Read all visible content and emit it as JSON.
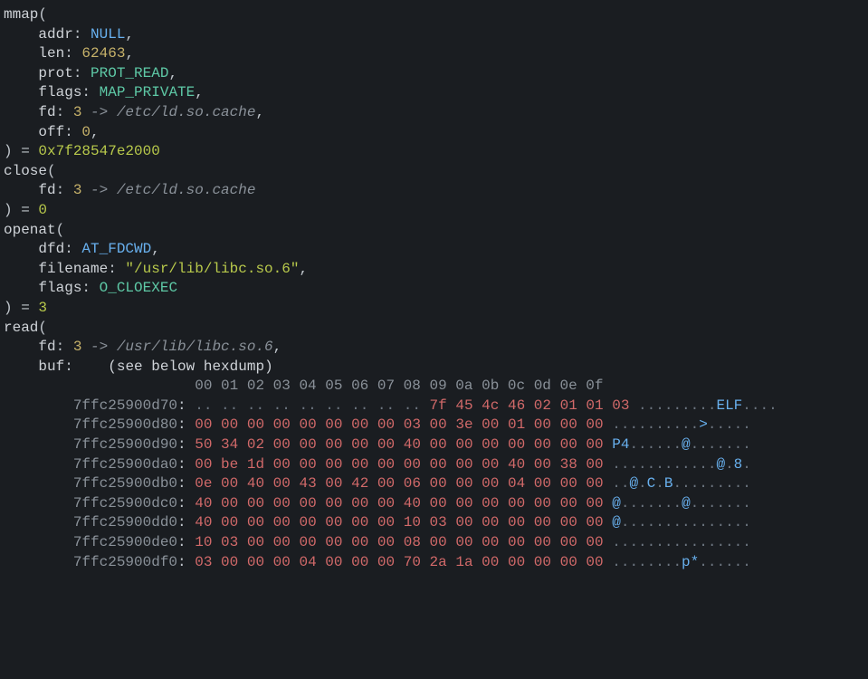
{
  "syscalls": [
    {
      "name": "mmap",
      "params": [
        {
          "key": "addr",
          "value": "NULL",
          "cls": "null"
        },
        {
          "key": "len",
          "value": "62463",
          "cls": "num"
        },
        {
          "key": "prot",
          "value": "PROT_READ",
          "cls": "flag"
        },
        {
          "key": "flags",
          "value": "MAP_PRIVATE",
          "cls": "flag"
        },
        {
          "key": "fd",
          "value": "3",
          "cls": "fd",
          "follow": " -> /etc/ld.so.cache",
          "followcls": "path"
        },
        {
          "key": "off",
          "value": "0",
          "cls": "num"
        }
      ],
      "ret": "0x7f28547e2000"
    },
    {
      "name": "close",
      "params": [
        {
          "key": "fd",
          "value": "3",
          "cls": "fd",
          "follow": " -> /etc/ld.so.cache",
          "followcls": "path",
          "nocomma": true
        }
      ],
      "ret": "0"
    },
    {
      "name": "openat",
      "params": [
        {
          "key": "dfd",
          "value": "AT_FDCWD",
          "cls": "null"
        },
        {
          "key": "filename",
          "value": "\"/usr/lib/libc.so.6\"",
          "cls": "str"
        },
        {
          "key": "flags",
          "value": "O_CLOEXEC",
          "cls": "flag",
          "nocomma": true
        }
      ],
      "ret": "3"
    }
  ],
  "read": {
    "name": "read",
    "fd_label": "fd",
    "fd_value": "3",
    "fd_follow": " -> /usr/lib/libc.so.6",
    "buf_label": "buf",
    "buf_note": "(see below hexdump)"
  },
  "hexdump": {
    "header": "00 01 02 03 04 05 06 07 08 09 0a 0b 0c 0d 0e 0f",
    "rows": [
      {
        "addr": "7ffc25900d70",
        "lead_dots": 9,
        "bytes": [
          "7f",
          "45",
          "4c",
          "46",
          "02",
          "01",
          "01",
          "03"
        ],
        "ascii": [
          {
            "t": ".........",
            "c": "ascii"
          },
          {
            "t": "ELF",
            "c": "asciih"
          },
          {
            "t": "....",
            "c": "ascii"
          }
        ]
      },
      {
        "addr": "7ffc25900d80",
        "lead_dots": 0,
        "bytes": [
          "00",
          "00",
          "00",
          "00",
          "00",
          "00",
          "00",
          "00",
          "03",
          "00",
          "3e",
          "00",
          "01",
          "00",
          "00",
          "00"
        ],
        "ascii": [
          {
            "t": "..........",
            "c": "ascii"
          },
          {
            "t": ">",
            "c": "asciih"
          },
          {
            "t": ".....",
            "c": "ascii"
          }
        ]
      },
      {
        "addr": "7ffc25900d90",
        "lead_dots": 0,
        "bytes": [
          "50",
          "34",
          "02",
          "00",
          "00",
          "00",
          "00",
          "00",
          "40",
          "00",
          "00",
          "00",
          "00",
          "00",
          "00",
          "00"
        ],
        "ascii": [
          {
            "t": "P4",
            "c": "asciih"
          },
          {
            "t": "......",
            "c": "ascii"
          },
          {
            "t": "@",
            "c": "asciih"
          },
          {
            "t": ".......",
            "c": "ascii"
          }
        ]
      },
      {
        "addr": "7ffc25900da0",
        "lead_dots": 0,
        "bytes": [
          "00",
          "be",
          "1d",
          "00",
          "00",
          "00",
          "00",
          "00",
          "00",
          "00",
          "00",
          "00",
          "40",
          "00",
          "38",
          "00"
        ],
        "ascii": [
          {
            "t": "............",
            "c": "ascii"
          },
          {
            "t": "@",
            "c": "asciih"
          },
          {
            "t": ".",
            "c": "ascii"
          },
          {
            "t": "8",
            "c": "asciih"
          },
          {
            "t": ".",
            "c": "ascii"
          }
        ]
      },
      {
        "addr": "7ffc25900db0",
        "lead_dots": 0,
        "bytes": [
          "0e",
          "00",
          "40",
          "00",
          "43",
          "00",
          "42",
          "00",
          "06",
          "00",
          "00",
          "00",
          "04",
          "00",
          "00",
          "00"
        ],
        "ascii": [
          {
            "t": "..",
            "c": "ascii"
          },
          {
            "t": "@",
            "c": "asciih"
          },
          {
            "t": ".",
            "c": "ascii"
          },
          {
            "t": "C",
            "c": "asciih"
          },
          {
            "t": ".",
            "c": "ascii"
          },
          {
            "t": "B",
            "c": "asciih"
          },
          {
            "t": ".........",
            "c": "ascii"
          }
        ]
      },
      {
        "addr": "7ffc25900dc0",
        "lead_dots": 0,
        "bytes": [
          "40",
          "00",
          "00",
          "00",
          "00",
          "00",
          "00",
          "00",
          "40",
          "00",
          "00",
          "00",
          "00",
          "00",
          "00",
          "00"
        ],
        "ascii": [
          {
            "t": "@",
            "c": "asciih"
          },
          {
            "t": ".......",
            "c": "ascii"
          },
          {
            "t": "@",
            "c": "asciih"
          },
          {
            "t": ".......",
            "c": "ascii"
          }
        ]
      },
      {
        "addr": "7ffc25900dd0",
        "lead_dots": 0,
        "bytes": [
          "40",
          "00",
          "00",
          "00",
          "00",
          "00",
          "00",
          "00",
          "10",
          "03",
          "00",
          "00",
          "00",
          "00",
          "00",
          "00"
        ],
        "ascii": [
          {
            "t": "@",
            "c": "asciih"
          },
          {
            "t": "...............",
            "c": "ascii"
          }
        ]
      },
      {
        "addr": "7ffc25900de0",
        "lead_dots": 0,
        "bytes": [
          "10",
          "03",
          "00",
          "00",
          "00",
          "00",
          "00",
          "00",
          "08",
          "00",
          "00",
          "00",
          "00",
          "00",
          "00",
          "00"
        ],
        "ascii": [
          {
            "t": "................",
            "c": "ascii"
          }
        ]
      },
      {
        "addr": "7ffc25900df0",
        "lead_dots": 0,
        "bytes": [
          "03",
          "00",
          "00",
          "00",
          "04",
          "00",
          "00",
          "00",
          "70",
          "2a",
          "1a",
          "00",
          "00",
          "00",
          "00",
          "00"
        ],
        "ascii": [
          {
            "t": "........",
            "c": "ascii"
          },
          {
            "t": "p*",
            "c": "asciih"
          },
          {
            "t": "......",
            "c": "ascii"
          }
        ]
      }
    ]
  }
}
